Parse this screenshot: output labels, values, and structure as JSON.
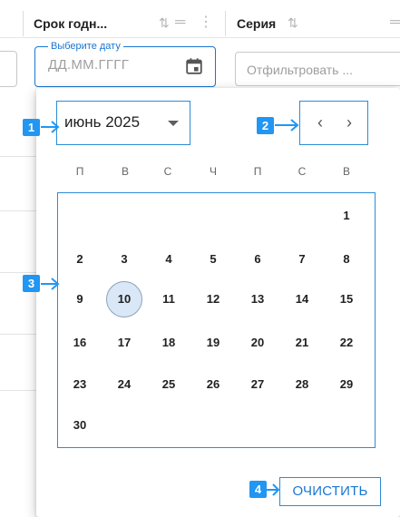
{
  "columns": {
    "expiry": {
      "title": "Срок годн..."
    },
    "series": {
      "title": "Серия"
    }
  },
  "filters": {
    "date": {
      "legend": "Выберите дату",
      "placeholder": "ДД.ММ.ГГГГ"
    },
    "series": {
      "placeholder": "Отфильтровать ..."
    }
  },
  "calendar": {
    "month_label": "июнь 2025",
    "nav": {
      "prev": "‹",
      "next": "›"
    },
    "weekdays": [
      "П",
      "В",
      "С",
      "Ч",
      "П",
      "С",
      "В"
    ],
    "weeks": [
      [
        "",
        "",
        "",
        "",
        "",
        "",
        "1"
      ],
      [
        "2",
        "3",
        "4",
        "5",
        "6",
        "7",
        "8"
      ],
      [
        "9",
        "10",
        "11",
        "12",
        "13",
        "14",
        "15"
      ],
      [
        "16",
        "17",
        "18",
        "19",
        "20",
        "21",
        "22"
      ],
      [
        "23",
        "24",
        "25",
        "26",
        "27",
        "28",
        "29"
      ],
      [
        "30",
        "",
        "",
        "",
        "",
        "",
        ""
      ]
    ],
    "selected_day": "10",
    "clear_label": "ОЧИСТИТЬ"
  },
  "callouts": [
    "1",
    "2",
    "3",
    "4"
  ],
  "colors": {
    "accent": "#1976d2",
    "callout": "#2196f3",
    "selected_bg": "#d9e7f7"
  }
}
